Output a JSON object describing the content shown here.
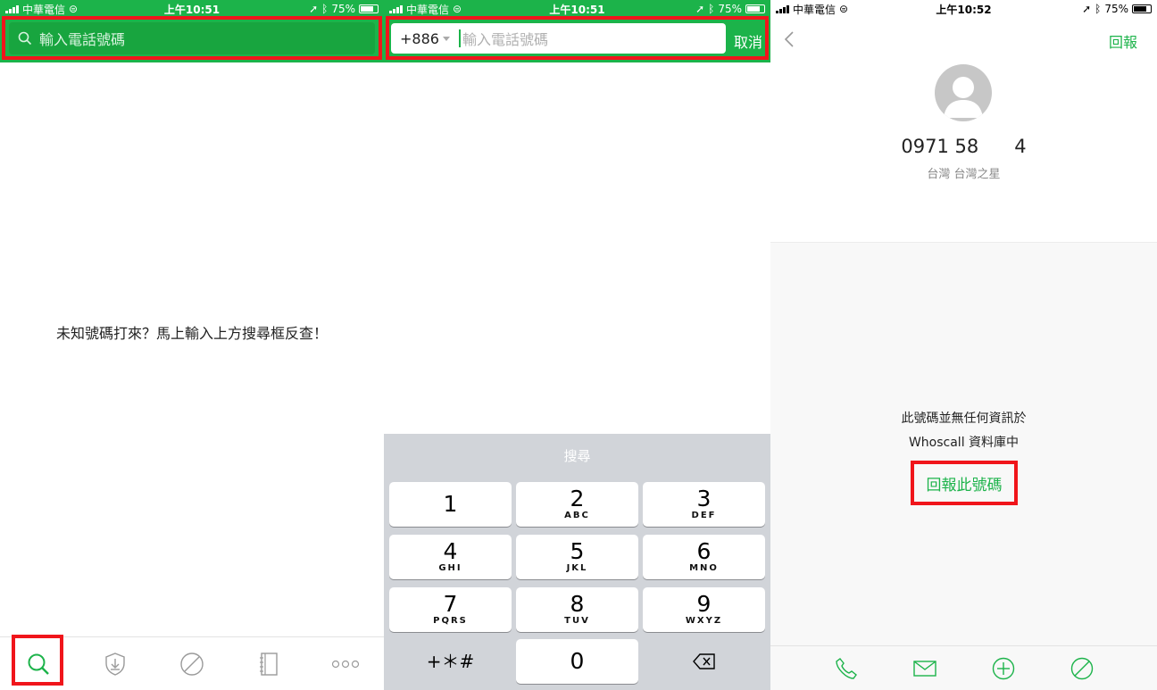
{
  "status_bar": {
    "carrier": "中華電信",
    "battery": "75%",
    "times": [
      "上午10:51",
      "上午10:51",
      "上午10:52"
    ]
  },
  "search_screen": {
    "search_placeholder": "輸入電話號碼",
    "hint": "未知號碼打來？馬上輸入上方搜尋框反查！",
    "tabs": [
      "search-icon",
      "shield-download-icon",
      "block-icon",
      "notebook-icon",
      "more-icon"
    ]
  },
  "input_screen": {
    "country_code": "+886",
    "placeholder": "輸入電話號碼",
    "cancel": "取消",
    "keyboard_title": "搜尋",
    "keys": [
      {
        "num": "1",
        "letters": ""
      },
      {
        "num": "2",
        "letters": "ABC"
      },
      {
        "num": "3",
        "letters": "DEF"
      },
      {
        "num": "4",
        "letters": "GHI"
      },
      {
        "num": "5",
        "letters": "JKL"
      },
      {
        "num": "6",
        "letters": "MNO"
      },
      {
        "num": "7",
        "letters": "PQRS"
      },
      {
        "num": "8",
        "letters": "TUV"
      },
      {
        "num": "9",
        "letters": "WXYZ"
      },
      {
        "num": "+＊#",
        "letters": ""
      },
      {
        "num": "0",
        "letters": ""
      }
    ]
  },
  "result_screen": {
    "report_top": "回報",
    "phone_number": "0971 58      4",
    "location": "台灣 台灣之星",
    "info_line1": "此號碼並無任何資訊於",
    "info_line2": "Whoscall 資料庫中",
    "report_link": "回報此號碼",
    "actions": [
      "phone-icon",
      "mail-icon",
      "add-icon",
      "block-icon"
    ]
  },
  "colors": {
    "brand_green": "#1cb34a",
    "highlight_red": "#f0151b"
  }
}
